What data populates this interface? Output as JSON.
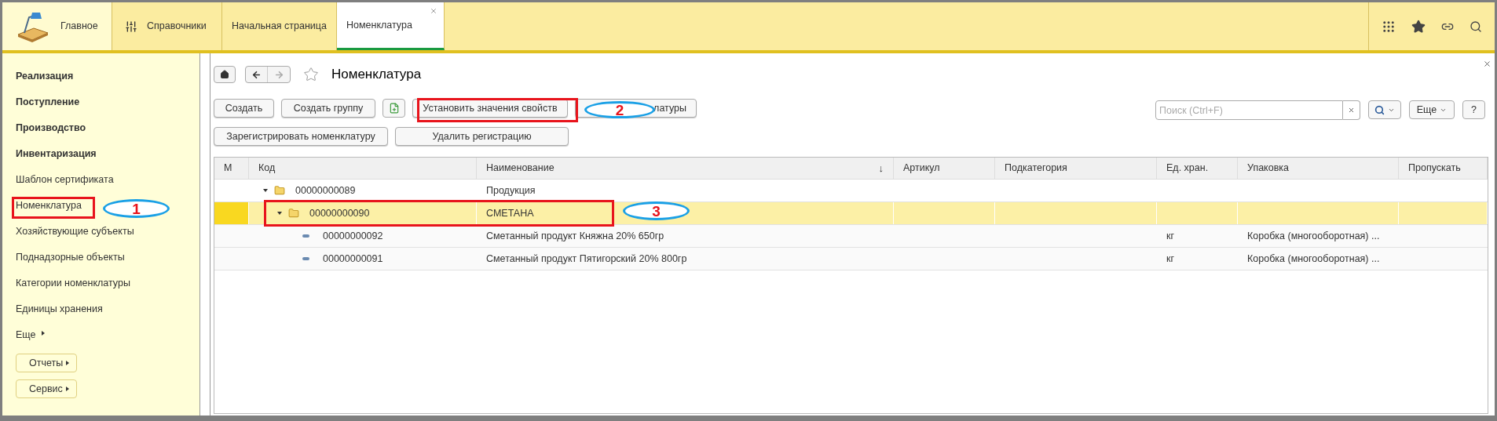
{
  "top_bar": {
    "sections": [
      {
        "kind": "home",
        "label": "Главное"
      },
      {
        "kind": "menu",
        "label": "Справочники"
      }
    ],
    "tabs": [
      {
        "label": "Начальная страница",
        "selected": false,
        "closable": false
      },
      {
        "label": "Номенклатура",
        "selected": true,
        "closable": true
      }
    ]
  },
  "sidebar": {
    "items": [
      {
        "kind": "section",
        "label": "Реализация"
      },
      {
        "kind": "section",
        "label": "Поступление"
      },
      {
        "kind": "section",
        "label": "Производство"
      },
      {
        "kind": "section",
        "label": "Инвентаризация"
      },
      {
        "kind": "link",
        "label": "Шаблон сертификата"
      },
      {
        "kind": "link",
        "label": "Номенклатура"
      },
      {
        "kind": "link",
        "label": "Хозяйствующие субъекты"
      },
      {
        "kind": "link",
        "label": "Поднадзорные объекты"
      },
      {
        "kind": "link",
        "label": "Категории номенклатуры"
      },
      {
        "kind": "link",
        "label": "Единицы хранения"
      },
      {
        "kind": "more",
        "label": "Еще"
      }
    ],
    "buttons": [
      "Отчеты",
      "Сервис"
    ]
  },
  "page": {
    "title": "Номенклатура",
    "favorite": false,
    "toolbar_rows": [
      [
        {
          "kind": "text",
          "label": "Создать"
        },
        {
          "kind": "text",
          "label": "Создать группу"
        },
        {
          "kind": "icon"
        },
        {
          "kind": "text",
          "label": "Установить значения свойств"
        },
        {
          "kind": "covered",
          "label": "латуры"
        }
      ],
      [
        {
          "kind": "text",
          "label": "Зарегистрировать номенклатуру"
        },
        {
          "kind": "text",
          "label": "Удалить регистрацию"
        }
      ]
    ],
    "search": {
      "placeholder": "Поиск (Ctrl+F)"
    },
    "more_button": "Еще",
    "help_button": "?"
  },
  "table": {
    "columns": [
      {
        "label": "М"
      },
      {
        "label": "Код"
      },
      {
        "label": "Наименование",
        "sort": "↓"
      },
      {
        "label": "Артикул"
      },
      {
        "label": "Подкатегория"
      },
      {
        "label": "Ед. хран."
      },
      {
        "label": "Упаковка"
      },
      {
        "label": "Пропускать"
      }
    ],
    "rows": [
      {
        "kind": "group",
        "code": "00000000089",
        "name": "Продукция",
        "selected": false,
        "expanded": true,
        "children": [
          {
            "kind": "group",
            "code": "00000000090",
            "name": "СМЕТАНА",
            "selected": true,
            "expanded": true,
            "children": [
              {
                "kind": "item",
                "code": "00000000092",
                "name": "Сметанный продукт Княжна 20% 650гр",
                "unit": "кг",
                "packaging": "Коробка (многооборотная) ...",
                "selected": false
              },
              {
                "kind": "item",
                "code": "00000000091",
                "name": "Сметанный продукт Пятигорский 20% 800гр",
                "unit": "кг",
                "packaging": "Коробка (многооборотная) ...",
                "selected": false
              }
            ]
          }
        ]
      }
    ]
  },
  "annotations": [
    {
      "number": "1"
    },
    {
      "number": "2"
    },
    {
      "number": "3"
    }
  ]
}
